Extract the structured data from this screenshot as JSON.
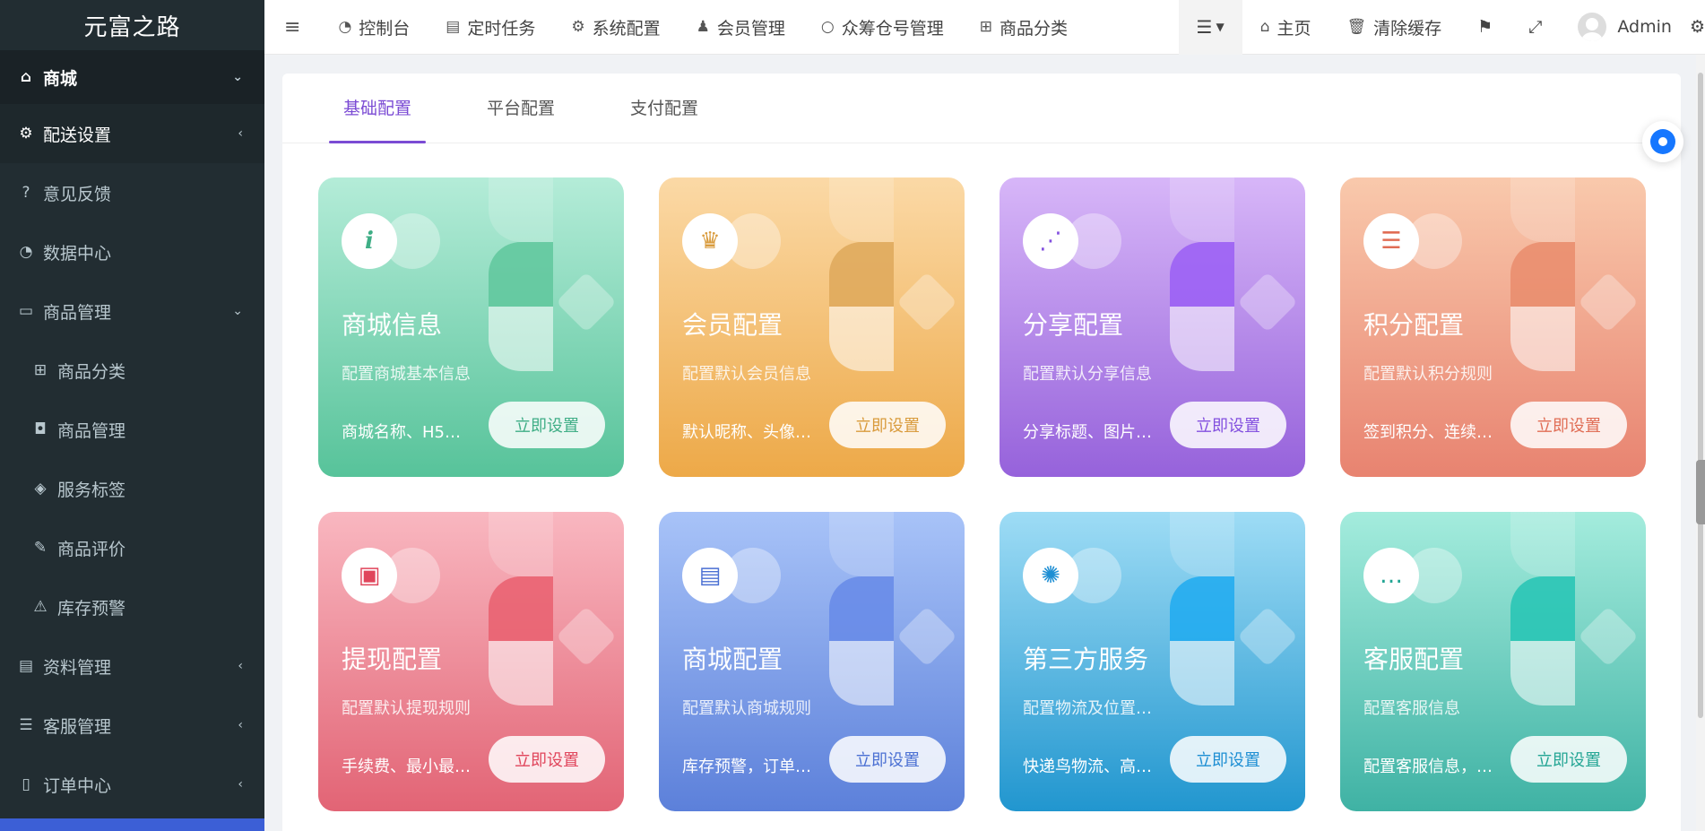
{
  "app": {
    "logo": "元富之路"
  },
  "sidebar": {
    "items": [
      {
        "label": "商城",
        "icon": "home-icon",
        "arrow": "⌄"
      },
      {
        "label": "配送设置",
        "icon": "gears-icon",
        "arrow": "‹"
      },
      {
        "label": "意见反馈",
        "icon": "question-circle-icon"
      },
      {
        "label": "数据中心",
        "icon": "dashboard-icon"
      },
      {
        "label": "商品管理",
        "icon": "archive-icon",
        "arrow": "⌄"
      },
      {
        "label": "商品分类",
        "icon": "sitemap-icon"
      },
      {
        "label": "商品管理",
        "icon": "shopping-bag-icon"
      },
      {
        "label": "服务标签",
        "icon": "tags-icon"
      },
      {
        "label": "商品评价",
        "icon": "edit-square-icon"
      },
      {
        "label": "库存预警",
        "icon": "warning-icon"
      },
      {
        "label": "资料管理",
        "icon": "file-text-icon",
        "arrow": "‹"
      },
      {
        "label": "客服管理",
        "icon": "list-icon",
        "arrow": "‹"
      },
      {
        "label": "订单中心",
        "icon": "file-icon",
        "arrow": "‹"
      }
    ]
  },
  "navbar": {
    "links": [
      {
        "label": "控制台",
        "icon": "dashboard-icon"
      },
      {
        "label": "定时任务",
        "icon": "tasks-icon"
      },
      {
        "label": "系统配置",
        "icon": "gear-icon"
      },
      {
        "label": "会员管理",
        "icon": "user-icon"
      },
      {
        "label": "众筹仓号管理",
        "icon": "circle-icon"
      },
      {
        "label": "商品分类",
        "icon": "sitemap-icon"
      }
    ],
    "right": {
      "home": "主页",
      "clear_cache": "清除缓存",
      "user": "Admin"
    }
  },
  "tabs": [
    "基础配置",
    "平台配置",
    "支付配置"
  ],
  "cards": [
    {
      "title": "商城信息",
      "desc": "配置商城基本信息",
      "detail": "商城名称、H5…",
      "button": "立即设置",
      "icon": "info-icon",
      "glyph": "i"
    },
    {
      "title": "会员配置",
      "desc": "配置默认会员信息",
      "detail": "默认昵称、头像…",
      "button": "立即设置",
      "icon": "crown-icon",
      "glyph": "♛"
    },
    {
      "title": "分享配置",
      "desc": "配置默认分享信息",
      "detail": "分享标题、图片…",
      "button": "立即设置",
      "icon": "share-icon",
      "glyph": "⋰"
    },
    {
      "title": "积分配置",
      "desc": "配置默认积分规则",
      "detail": "签到积分、连续…",
      "button": "立即设置",
      "icon": "database-icon",
      "glyph": "☰"
    },
    {
      "title": "提现配置",
      "desc": "配置默认提现规则",
      "detail": "手续费、最小最…",
      "button": "立即设置",
      "icon": "wallet-icon",
      "glyph": "▣"
    },
    {
      "title": "商城配置",
      "desc": "配置默认商城规则",
      "detail": "库存预警，订单…",
      "button": "立即设置",
      "icon": "clipboard-icon",
      "glyph": "▤"
    },
    {
      "title": "第三方服务",
      "desc": "配置物流及位置…",
      "detail": "快递鸟物流、高…",
      "button": "立即设置",
      "icon": "atom-icon",
      "glyph": "✺"
    },
    {
      "title": "客服配置",
      "desc": "配置客服信息",
      "detail": "配置客服信息，…",
      "button": "立即设置",
      "icon": "chat-icon",
      "glyph": "…"
    }
  ]
}
